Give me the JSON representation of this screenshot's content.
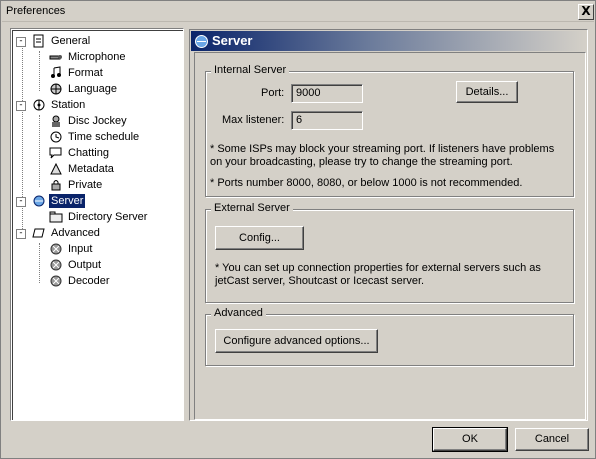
{
  "window": {
    "title": "Preferences",
    "close_label": "X"
  },
  "tree": {
    "items": [
      {
        "label": "General",
        "icon": "general-icon",
        "expander": "-"
      },
      {
        "label": "Microphone",
        "icon": "microphone-icon"
      },
      {
        "label": "Format",
        "icon": "format-icon"
      },
      {
        "label": "Language",
        "icon": "language-icon"
      },
      {
        "label": "Station",
        "icon": "station-icon",
        "expander": "-"
      },
      {
        "label": "Disc Jockey",
        "icon": "disc-jockey-icon"
      },
      {
        "label": "Time schedule",
        "icon": "time-schedule-icon"
      },
      {
        "label": "Chatting",
        "icon": "chatting-icon"
      },
      {
        "label": "Metadata",
        "icon": "metadata-icon"
      },
      {
        "label": "Private",
        "icon": "private-icon"
      },
      {
        "label": "Server",
        "icon": "server-icon",
        "expander": "-",
        "selected": true
      },
      {
        "label": "Directory Server",
        "icon": "directory-server-icon"
      },
      {
        "label": "Advanced",
        "icon": "advanced-icon",
        "expander": "-"
      },
      {
        "label": "Input",
        "icon": "input-icon"
      },
      {
        "label": "Output",
        "icon": "output-icon"
      },
      {
        "label": "Decoder",
        "icon": "decoder-icon"
      }
    ]
  },
  "pane": {
    "title": "Server",
    "internal": {
      "legend": "Internal Server",
      "port_label": "Port:",
      "port_value": "9000",
      "max_label": "Max listener:",
      "max_value": "6",
      "details_button": "Details...",
      "note1": "* Some ISPs may block your streaming port. If listeners have problems on your broadcasting, please try to change the streaming port.",
      "note2": "* Ports number 8000, 8080, or below 1000 is not recommended."
    },
    "external": {
      "legend": "External Server",
      "config_button": "Config...",
      "note": "* You can set up connection properties for external servers such as jetCast server, Shoutcast or Icecast server."
    },
    "advanced": {
      "legend": "Advanced",
      "configure_button": "Configure advanced options..."
    }
  },
  "footer": {
    "ok": "OK",
    "cancel": "Cancel"
  },
  "colors": {
    "face": "#d4d0c8",
    "selection": "#0a246a",
    "header_start": "#0a246a"
  }
}
